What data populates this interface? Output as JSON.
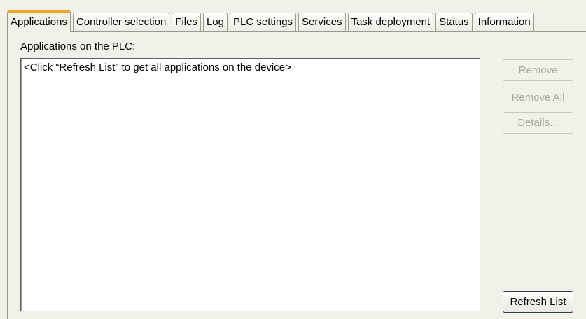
{
  "tabs": [
    {
      "label": "Applications",
      "active": true
    },
    {
      "label": "Controller selection",
      "active": false
    },
    {
      "label": "Files",
      "active": false
    },
    {
      "label": "Log",
      "active": false
    },
    {
      "label": "PLC settings",
      "active": false
    },
    {
      "label": "Services",
      "active": false
    },
    {
      "label": "Task deployment",
      "active": false
    },
    {
      "label": "Status",
      "active": false
    },
    {
      "label": "Information",
      "active": false
    }
  ],
  "panel": {
    "label": "Applications on the PLC:",
    "list_placeholder": "<Click “Refresh List” to get all applications on the device>"
  },
  "buttons": {
    "remove": "Remove",
    "remove_all": "Remove All",
    "details": "Details...",
    "refresh": "Refresh List"
  },
  "colors": {
    "background": "#f2f1e9",
    "active_tab_accent": "#f0a325",
    "disabled_text": "#a9a89e"
  }
}
